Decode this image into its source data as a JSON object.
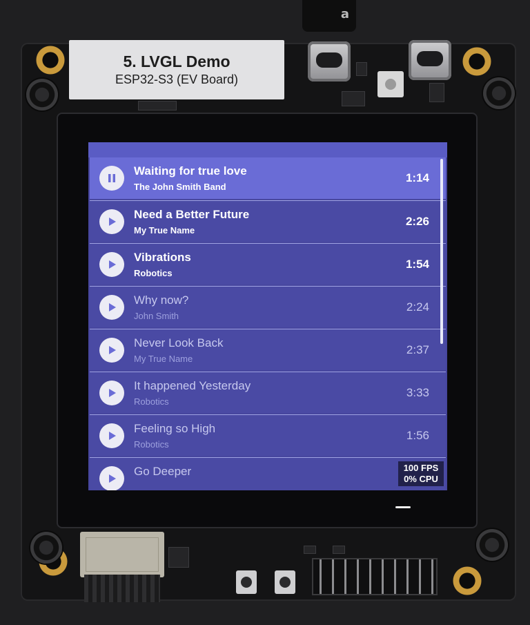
{
  "board_label": {
    "title": "5. LVGL Demo",
    "subtitle": "ESP32-S3 (EV Board)"
  },
  "usb_cable_mark": "a",
  "tracks": [
    {
      "title": "Waiting for true love",
      "artist": "The John Smith Band",
      "time": "1:14",
      "state": "playing",
      "icon": "pause-icon"
    },
    {
      "title": "Need a Better Future",
      "artist": "My True Name",
      "time": "2:26",
      "state": "paused",
      "icon": "play-icon"
    },
    {
      "title": "Vibrations",
      "artist": "Robotics",
      "time": "1:54",
      "state": "paused",
      "icon": "play-icon"
    },
    {
      "title": "Why now?",
      "artist": "John Smith",
      "time": "2:24",
      "state": "paused",
      "icon": "play-icon"
    },
    {
      "title": "Never Look Back",
      "artist": "My True Name",
      "time": "2:37",
      "state": "paused",
      "icon": "play-icon"
    },
    {
      "title": "It happened Yesterday",
      "artist": "Robotics",
      "time": "3:33",
      "state": "paused",
      "icon": "play-icon"
    },
    {
      "title": "Feeling so High",
      "artist": "Robotics",
      "time": "1:56",
      "state": "paused",
      "icon": "play-icon"
    },
    {
      "title": "Go Deeper",
      "artist": "",
      "time": "",
      "state": "paused",
      "icon": "play-icon"
    }
  ],
  "perf_monitor": {
    "fps": "100 FPS",
    "cpu": "0% CPU"
  },
  "colors": {
    "list_bg": "#4a4aa4",
    "active_row": "#6a6cd6",
    "divider": "#9fa3e3",
    "button_bg": "#ececf5",
    "icon_color": "#6a6cd6"
  }
}
